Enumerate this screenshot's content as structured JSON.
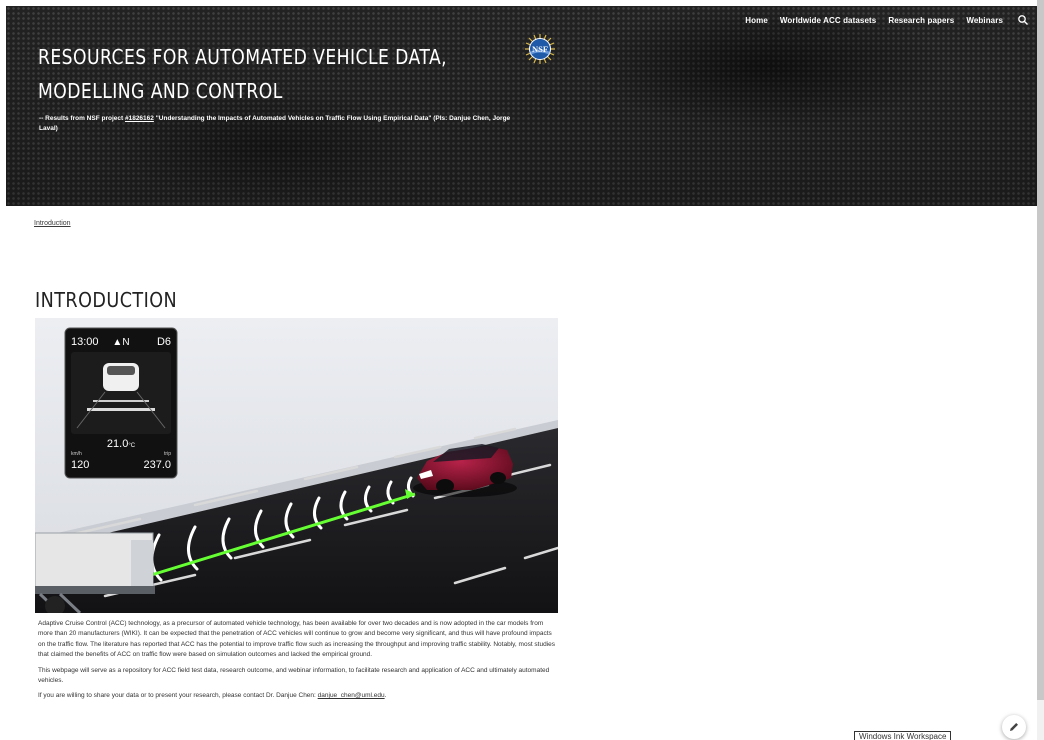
{
  "nav": {
    "items": [
      {
        "label": "Home"
      },
      {
        "label": "Worldwide ACC datasets"
      },
      {
        "label": "Research papers"
      },
      {
        "label": "Webinars"
      }
    ],
    "search_icon": "search-icon"
  },
  "header": {
    "title": "RESOURCES FOR AUTOMATED VEHICLE DATA, MODELLING AND CONTROL",
    "logo_icon": "nsf-logo",
    "logo_text": "NSF",
    "subtitle_prefix": "-- Results from NSF project ",
    "project_link": "#1826162",
    "subtitle_suffix": " \"Understanding the Impacts of Automated Vehicles on Traffic Flow Using Empirical Data\" (PIs: Danjue Chen, Jorge Laval)"
  },
  "breadcrumb": {
    "label": "Introduction"
  },
  "main": {
    "heading": "INTRODUCTION",
    "dashboard": {
      "time": "13:00",
      "heading_dir": "N",
      "gear": "D6",
      "temp_value": "21.0",
      "temp_unit": "°C",
      "speed_unit": "km/h",
      "speed": "120",
      "trip_label": "trip",
      "trip": "237.0"
    },
    "paragraphs": [
      "Adaptive Cruise Control (ACC) technology, as a precursor of automated vehicle technology, has been available for over two decades and is now adopted in the car models from more than 20 manufacturers (WIKI). It can be expected that the penetration of ACC vehicles will continue to grow and become very significant, and thus will have profound impacts on the traffic flow.  The literature has reported that ACC has the potential to improve traffic flow such as increasing the throughput and improving traffic stability. Notably, most studies that claimed the benefits of ACC on traffic flow were based on simulation outcomes and lacked the empirical ground.",
      "This webpage will serve as a repository for ACC field test data, research outcome, and webinar information, to facilitate research and application of ACC and ultimately automated vehicles."
    ],
    "contact_prefix": "If you are willing to share your data or to present your research, please contact Dr. Danjue Chen: ",
    "contact_email": "danjue_chen@uml.edu",
    "contact_suffix": "."
  },
  "overlay": {
    "ink_workspace_label": "Windows Ink Workspace",
    "edit_icon": "pencil-icon"
  },
  "colors": {
    "header_bg": "#282828",
    "ray_green": "#66ff33",
    "car_red": "#7a0a22"
  }
}
